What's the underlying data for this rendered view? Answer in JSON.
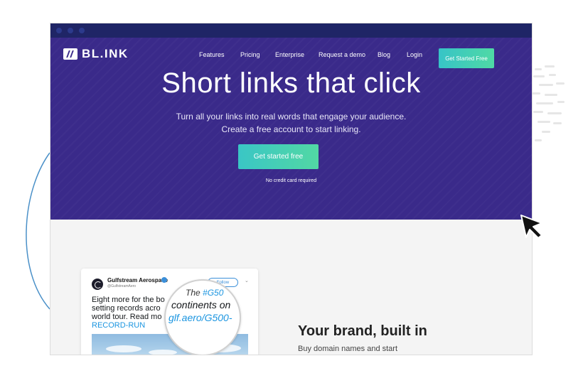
{
  "window": {
    "titlebar_dots": 3
  },
  "brand": {
    "logo_text": "BL.INK"
  },
  "nav": {
    "items": [
      "Features",
      "Pricing",
      "Enterprise",
      "Request a demo",
      "Blog",
      "Login"
    ],
    "cta_label": "Get Started Free"
  },
  "hero": {
    "title": "Short links that click",
    "subtitle_line1": "Turn all your links into real words that engage your audience.",
    "subtitle_line2": "Create a free account to start linking.",
    "button_label": "Get started free",
    "note": "No credit card required"
  },
  "tweet": {
    "account_name": "Gulfstream Aerospace",
    "handle": "@GulfstreamAero",
    "follow_label": "Follow",
    "line1": "Eight more for the bo",
    "line2": "setting records acro",
    "line3": "world tour. Read mo",
    "link_text": "RECORD-RUN"
  },
  "magnifier": {
    "line1_prefix": "The ",
    "line1_tag": "#G50",
    "line2": "continents on",
    "line3": "glf.aero/G500-"
  },
  "section": {
    "title": "Your brand, built in",
    "subtitle": "Buy domain names and start"
  },
  "colors": {
    "hero_bg": "#3a2a8a",
    "titlebar": "#1f2566",
    "cta_gradient_start": "#37c4c7",
    "cta_gradient_end": "#4fd9a5",
    "twitter_blue": "#1b95e0"
  }
}
